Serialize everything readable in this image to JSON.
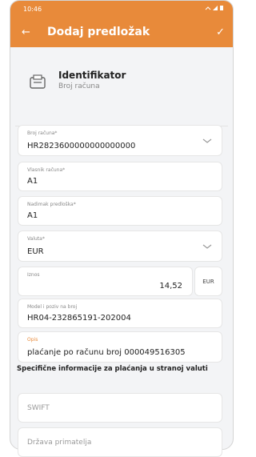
{
  "status": {
    "time": "10:46"
  },
  "appbar": {
    "title": "Dodaj predložak"
  },
  "identifier": {
    "title": "Identifikator",
    "subtitle": "Broj računa"
  },
  "fields": {
    "account": {
      "label": "Broj računa*",
      "value": "HR2823600000000000000"
    },
    "owner": {
      "label": "Vlasnik računa*",
      "value": "A1"
    },
    "nickname": {
      "label": "Nadimak predloška*",
      "value": "A1"
    },
    "currency": {
      "label": "Valuta*",
      "value": "EUR"
    },
    "amount": {
      "label": "Iznos",
      "value": "14,52",
      "currency": "EUR"
    },
    "model": {
      "label": "Model i poziv na broj",
      "value": "HR04-232865191-202004"
    },
    "description": {
      "label": "Opis",
      "value": "plaćanje po računu broj 000049516305"
    }
  },
  "section": {
    "title": "Specifične informacije za plaćanja u stranoj valuti"
  },
  "foreign": {
    "swift_placeholder": "SWIFT",
    "country_placeholder": "Država primatelja"
  },
  "colors": {
    "accent": "#e88a3a"
  }
}
